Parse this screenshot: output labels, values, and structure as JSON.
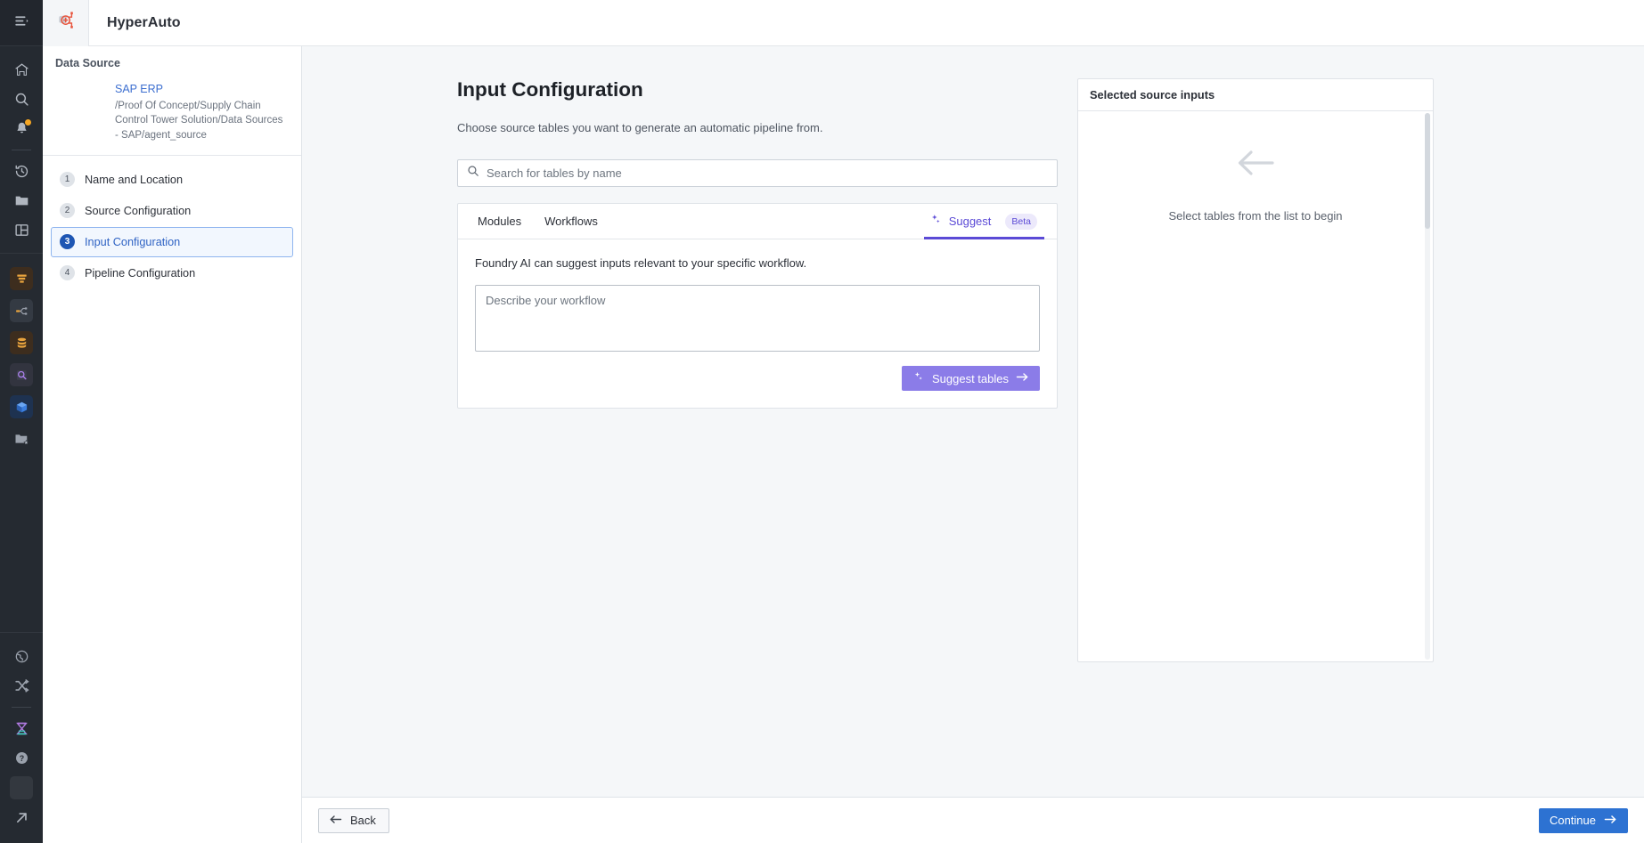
{
  "colors": {
    "accent_blue": "#2d72d2",
    "accent_purple": "#5b4ad6",
    "suggest_button": "#8b7ce8",
    "rail_bg": "#252a31",
    "page_bg": "#f5f7f9",
    "link_blue": "#3d6fd0"
  },
  "header": {
    "app_title": "HyperAuto",
    "logo_icon": "hyperauto-logo-icon",
    "collapse_icon": "panel-collapse-icon"
  },
  "rail": {
    "items": [
      {
        "icon": "home-icon",
        "name": "home"
      },
      {
        "icon": "search-icon",
        "name": "search"
      },
      {
        "icon": "notifications-bell-icon",
        "name": "notifications",
        "badge": true
      },
      {
        "icon": "history-clock-icon",
        "name": "history"
      },
      {
        "icon": "folder-icon",
        "name": "files"
      },
      {
        "icon": "layout-panels-icon",
        "name": "workspaces"
      },
      {
        "icon": "data-funnel-icon",
        "name": "pipeline-builder"
      },
      {
        "icon": "code-branch-icon",
        "name": "transforms"
      },
      {
        "icon": "database-icon",
        "name": "datasets"
      },
      {
        "icon": "contour-search-icon",
        "name": "contour"
      },
      {
        "icon": "cube-icon",
        "name": "ontology"
      },
      {
        "icon": "folder-star-icon",
        "name": "favorites"
      },
      {
        "icon": "globe-icon",
        "name": "globe"
      },
      {
        "icon": "shuffle-icon",
        "name": "shuffle"
      },
      {
        "icon": "hourglass-icon",
        "name": "jobs"
      },
      {
        "icon": "help-circle-icon",
        "name": "help"
      },
      {
        "icon": "user-avatar-icon",
        "name": "account"
      },
      {
        "icon": "external-link-arrow-icon",
        "name": "open-external"
      }
    ]
  },
  "wizard": {
    "data_source_label": "Data Source",
    "source_name": "SAP ERP",
    "source_path": "/Proof Of Concept/Supply Chain Control Tower Solution/Data Sources - SAP/agent_source",
    "steps": [
      {
        "num": "1",
        "label": "Name and Location",
        "active": false
      },
      {
        "num": "2",
        "label": "Source Configuration",
        "active": false
      },
      {
        "num": "3",
        "label": "Input Configuration",
        "active": true
      },
      {
        "num": "4",
        "label": "Pipeline Configuration",
        "active": false
      }
    ]
  },
  "main": {
    "title": "Input Configuration",
    "subtitle": "Choose source tables you want to generate an automatic pipeline from.",
    "search": {
      "placeholder": "Search for tables by name",
      "value": "",
      "icon": "search-icon"
    },
    "tabs": [
      {
        "label": "Modules",
        "active": false
      },
      {
        "label": "Workflows",
        "active": false
      }
    ],
    "suggest_tab": {
      "label": "Suggest",
      "badge": "Beta",
      "icon": "sparkle-icon",
      "active": true
    },
    "panel": {
      "description": "Foundry AI can suggest inputs relevant to your specific workflow.",
      "textarea_placeholder": "Describe your workflow",
      "textarea_value": "",
      "suggest_button_label": "Suggest tables",
      "suggest_button_icon": "sparkle-icon",
      "suggest_button_arrow": "arrow-right-icon"
    }
  },
  "selected_panel": {
    "title": "Selected source inputs",
    "empty_icon": "arrow-left-icon",
    "empty_text": "Select tables from the list to begin"
  },
  "footer": {
    "back_label": "Back",
    "back_icon": "arrow-left-icon",
    "continue_label": "Continue",
    "continue_icon": "arrow-right-icon"
  }
}
